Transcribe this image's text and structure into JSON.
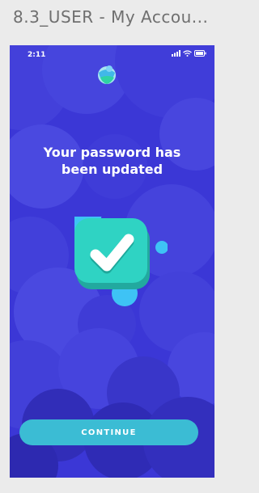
{
  "window": {
    "title": "8.3_USER - My Accou..."
  },
  "status_bar": {
    "time": "2:11",
    "icons": [
      "signal-icon",
      "wifi-icon",
      "battery-icon"
    ]
  },
  "logo": {
    "icon": "app-logo-icon"
  },
  "message": {
    "line1": "Your password has",
    "line2": "been updated"
  },
  "success_icon": "check-icon",
  "continue_button": {
    "label": "CONTINUE"
  },
  "colors": {
    "background": "#3b37d6",
    "bubble_light": "#4a49e0",
    "bubble_dark": "#2f2bb5",
    "check_badge": "#2fd3c3",
    "accent_dot": "#34c3f0",
    "button": "#3bbcd4",
    "text": "#ffffff"
  }
}
